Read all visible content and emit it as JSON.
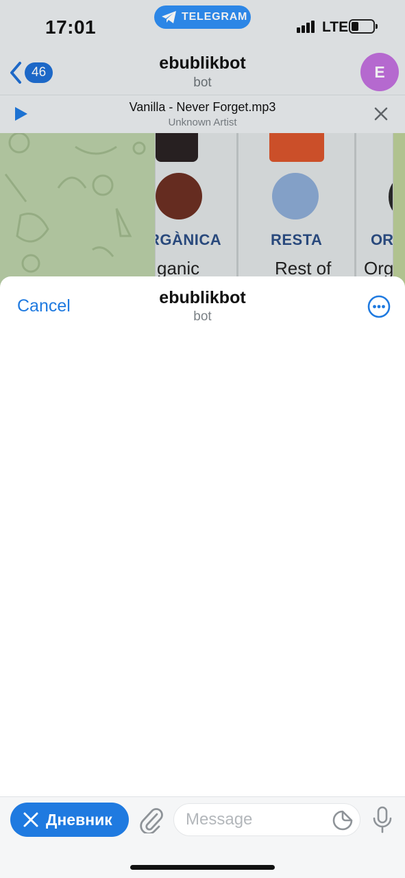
{
  "status_bar": {
    "time": "17:01",
    "network": "LTE",
    "battery_percent": 33
  },
  "return_pill": {
    "label": "TELEGRAM",
    "icon": "telegram-plane-icon",
    "color": "#2f8ff5"
  },
  "chat_header": {
    "back_badge": "46",
    "title": "ebublikbot",
    "subtitle": "bot",
    "avatar_letter": "E",
    "avatar_color": "#c170dc"
  },
  "audio_player": {
    "track": "Vanilla - Never Forget.mp3",
    "artist": "Unknown Artist"
  },
  "chat_photo": {
    "labels": [
      {
        "title": "RGÀNICA",
        "caption": "ganic"
      },
      {
        "title": "RESTA",
        "caption": "Rest of"
      },
      {
        "title": "OR",
        "caption": "Org"
      }
    ]
  },
  "webapp_sheet": {
    "cancel_label": "Cancel",
    "title": "ebublikbot",
    "subtitle": "bot",
    "more_icon": "ellipsis-circle-icon"
  },
  "input_bar": {
    "menu_button_label": "Дневник",
    "message_placeholder": "Message",
    "accent": "#1f7ae0"
  }
}
